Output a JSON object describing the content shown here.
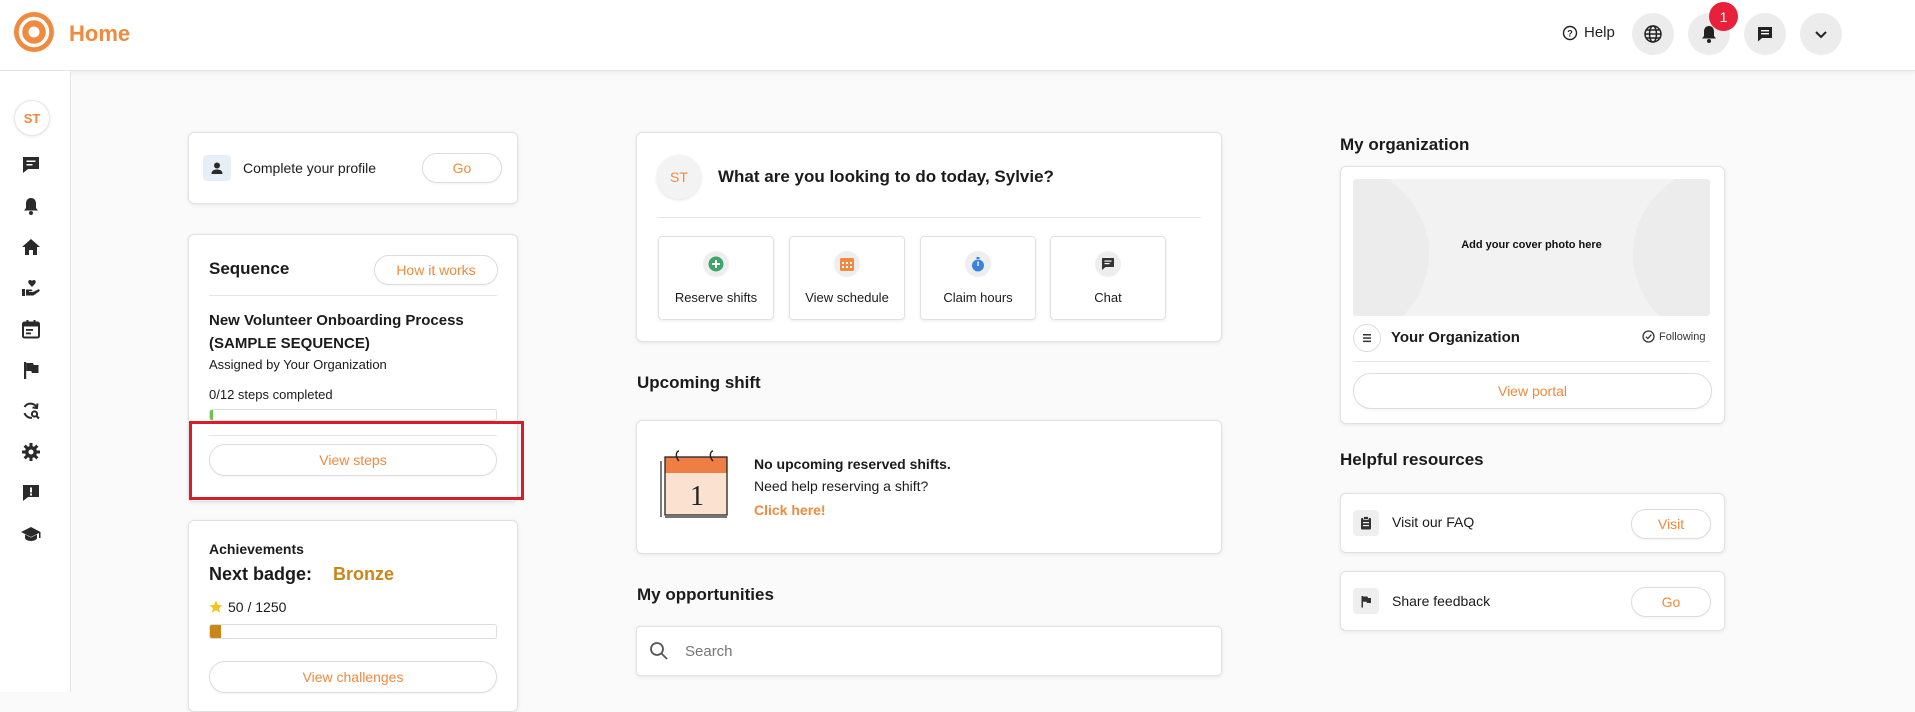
{
  "header": {
    "title": "Home",
    "help_label": "Help",
    "notification_count": "1",
    "icons": [
      "logo-icon",
      "help-icon",
      "globe-icon",
      "bell-icon",
      "chat-icon",
      "chevron-down-icon"
    ]
  },
  "sidebar": {
    "avatar_initials": "ST",
    "items": [
      "chat-icon",
      "bell-icon",
      "home-icon",
      "volunteer-hand-icon",
      "calendar-icon",
      "flag-icon",
      "refresh-search-icon",
      "gear-icon",
      "feedback-icon",
      "graduation-cap-icon"
    ]
  },
  "profile_card": {
    "label": "Complete your profile",
    "button": "Go"
  },
  "sequence": {
    "title": "Sequence",
    "how_it_works": "How it works",
    "name_line1": "New Volunteer Onboarding Process",
    "name_line2": "(SAMPLE SEQUENCE)",
    "assigned_by": "Assigned by Your Organization",
    "progress_text": "0/12 steps completed",
    "progress_fraction": 0,
    "view_steps": "View steps"
  },
  "achievements": {
    "title": "Achievements",
    "next_badge_label": "Next badge:",
    "badge_name": "Bronze",
    "points": "50 / 1250",
    "points_fraction": 0.04,
    "view_challenges": "View challenges"
  },
  "welcome": {
    "avatar_initials": "ST",
    "question": "What are you looking to do today, Sylvie?",
    "actions": [
      {
        "label": "Reserve shifts",
        "icon": "plus-circle-icon",
        "color": "#3fa56b"
      },
      {
        "label": "View schedule",
        "icon": "calendar-grid-icon",
        "color": "#f08a3e"
      },
      {
        "label": "Claim hours",
        "icon": "stopwatch-icon",
        "color": "#3b82e0"
      },
      {
        "label": "Chat",
        "icon": "chat-icon",
        "color": "#333333"
      }
    ]
  },
  "upcoming": {
    "title": "Upcoming shift",
    "calendar_day": "1",
    "no_shifts": "No upcoming reserved shifts.",
    "need_help": "Need help reserving a shift?",
    "click_here": "Click here!"
  },
  "opportunities": {
    "title": "My opportunities",
    "search_placeholder": "Search"
  },
  "organization": {
    "title": "My organization",
    "cover_text": "Add your cover photo here",
    "name": "Your Organization",
    "following": "Following",
    "view_portal": "View portal"
  },
  "resources": {
    "title": "Helpful resources",
    "faq_label": "Visit our FAQ",
    "faq_button": "Visit",
    "feedback_label": "Share feedback",
    "feedback_button": "Go"
  },
  "colors": {
    "accent": "#f08a3e",
    "badge_gold": "#c9861a",
    "alert_red": "#e8203a",
    "highlight_red": "#d71e28",
    "progress_green": "#6cc24a"
  }
}
